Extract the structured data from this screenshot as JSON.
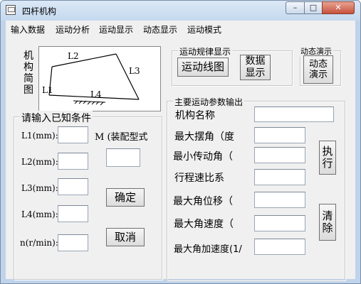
{
  "window": {
    "title": "四杆机构"
  },
  "window_buttons": {
    "minimize": "–",
    "maximize": "□",
    "close": "✕"
  },
  "menu": [
    "输入数据",
    "运动分析",
    "运动显示",
    "动态显示",
    "运动模式"
  ],
  "diagram": {
    "title_vertical": "机构简图",
    "labels": {
      "l1": "L1",
      "l2": "L2",
      "l3": "L3",
      "l4": "L4"
    }
  },
  "motion_display": {
    "group_label": "运动规律显示",
    "line_button": "运动线图",
    "data_button": "数据\n显示"
  },
  "dynamic_demo": {
    "group_label": "动态演示",
    "button": "动态\n演示"
  },
  "input_group": {
    "label": "请输入已知条件",
    "fields": [
      "L1(mm):",
      "L2(mm):",
      "L3(mm):",
      "L4(mm):",
      "n(r/min):"
    ],
    "values": [
      "",
      "",
      "",
      "",
      ""
    ],
    "m_label": "M (装配型式",
    "m_value": "",
    "confirm_button": "确定",
    "cancel_button": "取消"
  },
  "output_group": {
    "label": "主要运动参数输出",
    "rows": [
      "机构名称",
      "最大摆角（度",
      "最小传动角（",
      "行程速比系",
      "最大角位移（",
      "最大角速度（",
      "最大角加速度(1/"
    ],
    "values": [
      "",
      "",
      "",
      "",
      "",
      "",
      ""
    ],
    "execute_button": "执\n行",
    "clear_button": "清\n除"
  }
}
